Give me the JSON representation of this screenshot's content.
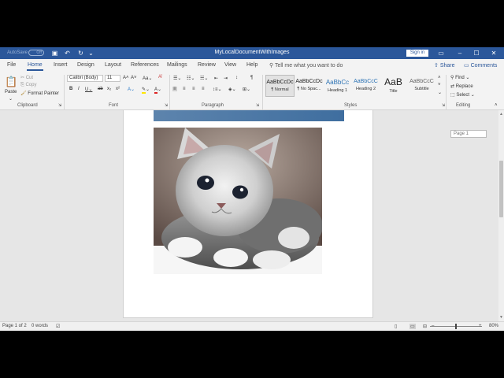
{
  "titlebar": {
    "autosave": "AutoSave",
    "autosave_state": "Off",
    "doc_title": "MyLocalDocumentWithImages",
    "sign_in": "Sign in"
  },
  "tabs": [
    "File",
    "Home",
    "Insert",
    "Design",
    "Layout",
    "References",
    "Mailings",
    "Review",
    "View",
    "Help"
  ],
  "tell_me": "Tell me what you want to do",
  "share": "Share",
  "comments": "Comments",
  "clipboard": {
    "paste": "Paste",
    "cut": "Cut",
    "copy": "Copy",
    "format_painter": "Format Painter",
    "label": "Clipboard"
  },
  "font": {
    "family": "Calibri (Body)",
    "size": "11",
    "label": "Font"
  },
  "paragraph": {
    "label": "Paragraph"
  },
  "styles": {
    "label": "Styles",
    "items": [
      {
        "sample": "AaBbCcDc",
        "name": "¶ Normal"
      },
      {
        "sample": "AaBbCcDc",
        "name": "¶ No Spac..."
      },
      {
        "sample": "AaBbCc",
        "name": "Heading 1"
      },
      {
        "sample": "AaBbCcC",
        "name": "Heading 2"
      },
      {
        "sample": "AaB",
        "name": "Title"
      },
      {
        "sample": "AaBbCcC",
        "name": "Subtitle"
      }
    ]
  },
  "editing": {
    "find": "Find",
    "replace": "Replace",
    "select": "Select",
    "label": "Editing"
  },
  "page_tooltip": "Page 1",
  "status": {
    "page": "Page 1 of 2",
    "words": "0 words",
    "zoom": "80%"
  },
  "colors": {
    "accent": "#2b579a",
    "image_header": "#4a75a3"
  }
}
